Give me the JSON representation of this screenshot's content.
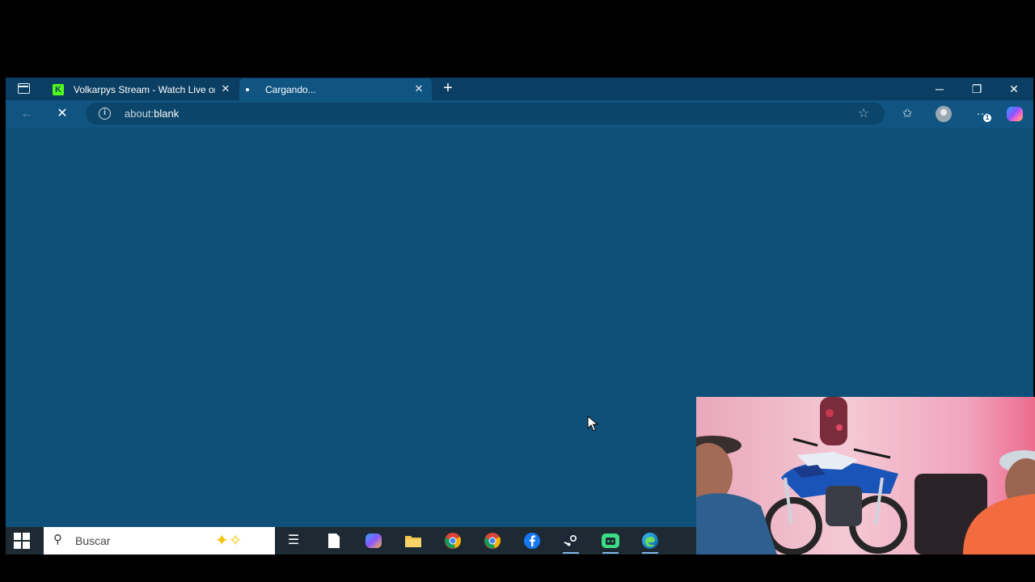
{
  "browser": {
    "tabs": [
      {
        "title": "Volkarpys Stream - Watch Live on",
        "icon": "kick-icon",
        "state": "inactive"
      },
      {
        "title": "Cargando...",
        "icon": "loading-dot",
        "state": "active"
      }
    ],
    "address": {
      "prefix": "about:",
      "host": "blank"
    }
  },
  "taskbar": {
    "search_placeholder": "Buscar",
    "apps": [
      "task-view-icon",
      "notepad-icon",
      "copilot-icon",
      "file-explorer-icon",
      "chrome-icon",
      "chrome-alt-icon",
      "facebook-icon",
      "steam-icon",
      "game-app-icon",
      "edge-icon"
    ]
  },
  "colors": {
    "page_bg": "#0f5079",
    "toolbar_bg": "#105482",
    "tabbar_bg": "#0a3f63",
    "kick_green": "#53fc18"
  }
}
